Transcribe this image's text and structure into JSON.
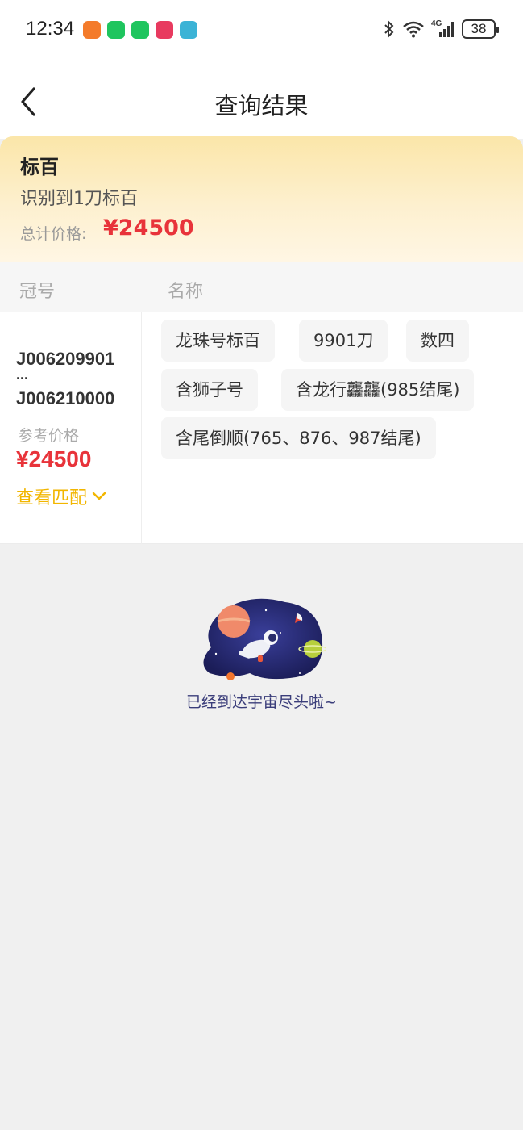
{
  "status_bar": {
    "time": "12:34",
    "network": "4G",
    "battery": "38",
    "icons": [
      "bluetooth-icon",
      "wifi-icon",
      "signal-icon"
    ]
  },
  "nav": {
    "title": "查询结果",
    "back_icon": "chevron-left-icon"
  },
  "summary": {
    "title": "标百",
    "description": "识别到1刀标百",
    "total_label": "总计价格:",
    "total_value": "¥24500"
  },
  "table": {
    "headers": {
      "serial": "冠号",
      "name": "名称"
    },
    "rows": [
      {
        "serial_start": "J006209901",
        "serial_sep": "...",
        "serial_end": "J006210000",
        "ref_price_label": "参考价格",
        "ref_price": "¥24500",
        "match_label": "查看匹配",
        "tags": [
          "龙珠号标百",
          "9901刀",
          "数四",
          "含狮子号",
          "含龙行龘龘(985结尾)",
          "含尾倒顺(765、876、987结尾)"
        ]
      }
    ]
  },
  "footer": {
    "end_text": "已经到达宇宙尽头啦~"
  },
  "colors": {
    "accent": "#f2b600",
    "price": "#e8333a",
    "background": "#f0f0f0"
  }
}
